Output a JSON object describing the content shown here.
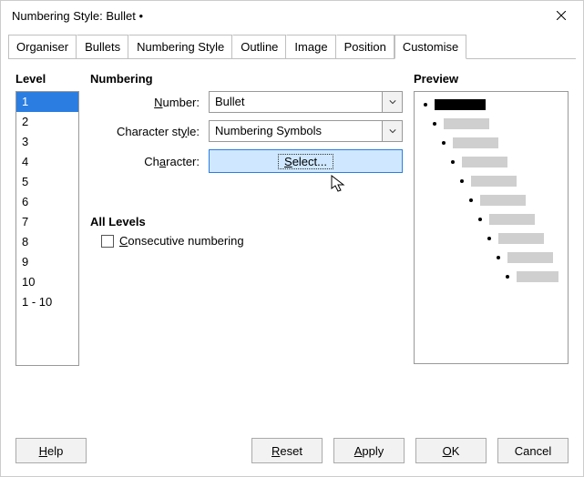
{
  "window": {
    "title": "Numbering Style: Bullet •"
  },
  "tabs": {
    "items": [
      {
        "label": "Organiser"
      },
      {
        "label": "Bullets"
      },
      {
        "label": "Numbering Style"
      },
      {
        "label": "Outline"
      },
      {
        "label": "Image"
      },
      {
        "label": "Position"
      },
      {
        "label": "Customise"
      }
    ],
    "active_index": 6
  },
  "level": {
    "heading": "Level",
    "items": [
      "1",
      "2",
      "3",
      "4",
      "5",
      "6",
      "7",
      "8",
      "9",
      "10",
      "1 - 10"
    ],
    "selected_index": 0
  },
  "numbering": {
    "heading": "Numbering",
    "number_label": "Number:",
    "number_value": "Bullet",
    "charstyle_label": "Character style:",
    "charstyle_value": "Numbering Symbols",
    "character_label": "Character:",
    "select_button": "Select..."
  },
  "all_levels": {
    "heading": "All Levels",
    "checkbox_label": "Consecutive numbering",
    "checked": false
  },
  "preview": {
    "heading": "Preview",
    "indent_step": 10,
    "bar_width_first": 56,
    "bar_width_rest": 50,
    "rows": 10,
    "active_row": 0
  },
  "buttons": {
    "help": "Help",
    "reset": "Reset",
    "apply": "Apply",
    "ok": "OK",
    "cancel": "Cancel"
  }
}
